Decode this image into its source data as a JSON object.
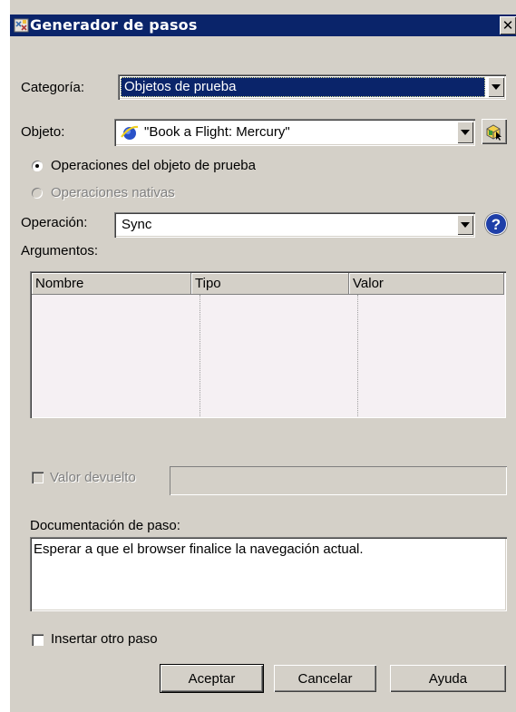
{
  "window": {
    "title": "Generador de pasos",
    "close_glyph": "✕"
  },
  "category": {
    "label": "Categoría:",
    "value": "Objetos de prueba"
  },
  "object": {
    "label": "Objeto:",
    "value": "\"Book a Flight: Mercury\""
  },
  "radio_options": {
    "test_object_ops": "Operaciones del objeto de prueba",
    "native_ops": "Operaciones nativas"
  },
  "operation": {
    "label": "Operación:",
    "value": "Sync"
  },
  "arguments": {
    "label": "Argumentos:",
    "columns": [
      "Nombre",
      "Tipo",
      "Valor"
    ],
    "rows": []
  },
  "return_value": {
    "label": "Valor devuelto",
    "value": ""
  },
  "documentation": {
    "label": "Documentación de paso:",
    "text": "Esperar a que el browser finalice la navegación actual."
  },
  "insert_another": {
    "label": "Insertar otro paso"
  },
  "buttons": {
    "ok": "Aceptar",
    "cancel": "Cancelar",
    "help": "Ayuda"
  },
  "colors": {
    "title_bar": "#0a246a",
    "selection": "#0a246a",
    "dialog_bg": "#d4d0c8"
  },
  "icons": {
    "title": "step-generator-icon",
    "object": "browser-globe-icon",
    "select_object": "object-picker-icon",
    "operation_help": "help-icon"
  }
}
